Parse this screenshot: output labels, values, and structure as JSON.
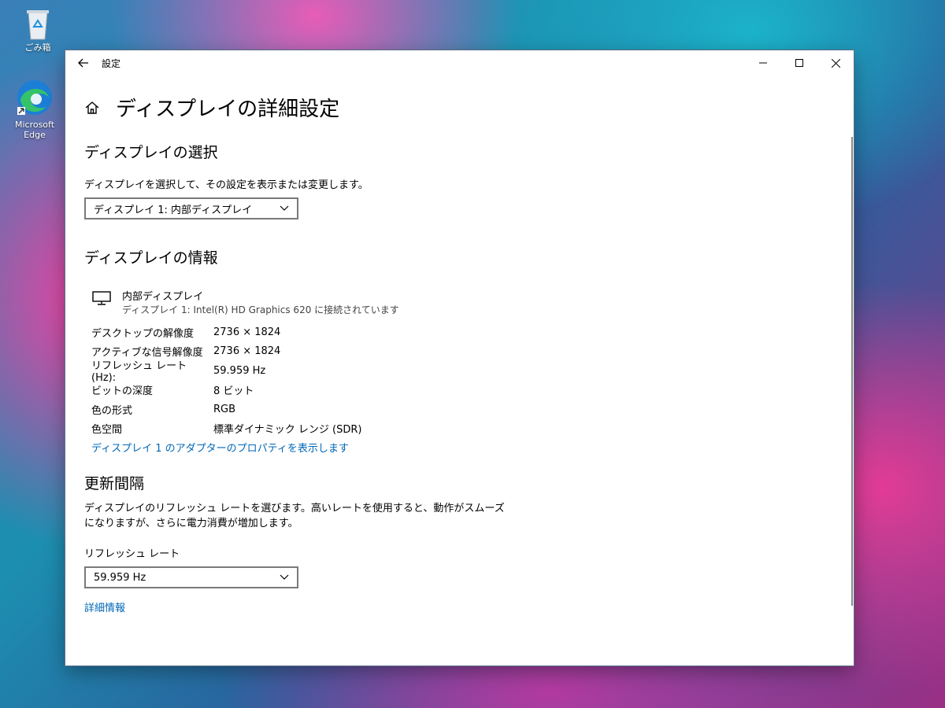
{
  "desktop": {
    "recycle_bin_label": "ごみ箱",
    "edge_label": "Microsoft Edge"
  },
  "window": {
    "title": "設定",
    "minimize": "─",
    "maximize": "☐",
    "close": "✕"
  },
  "page": {
    "title": "ディスプレイの詳細設定"
  },
  "select_display": {
    "heading": "ディスプレイの選択",
    "description": "ディスプレイを選択して、その設定を表示または変更します。",
    "selected": "ディスプレイ 1: 内部ディスプレイ"
  },
  "display_info": {
    "heading": "ディスプレイの情報",
    "monitor_name": "内部ディスプレイ",
    "monitor_sub": "ディスプレイ 1: Intel(R) HD Graphics 620 に接続されています",
    "rows": [
      {
        "label": "デスクトップの解像度",
        "value": "2736 × 1824"
      },
      {
        "label": "アクティブな信号解像度",
        "value": "2736 × 1824"
      },
      {
        "label": "リフレッシュ レート (Hz):",
        "value": "59.959 Hz"
      },
      {
        "label": "ビットの深度",
        "value": "8 ビット"
      },
      {
        "label": "色の形式",
        "value": "RGB"
      },
      {
        "label": "色空間",
        "value": "標準ダイナミック レンジ (SDR)"
      }
    ],
    "adapter_link": "ディスプレイ 1 のアダプターのプロパティを表示します"
  },
  "refresh": {
    "heading": "更新間隔",
    "description_line1": "ディスプレイのリフレッシュ レートを選びます。高いレートを使用すると、動作がスムーズ",
    "description_line2": "になりますが、さらに電力消費が増加します。",
    "rate_label": "リフレッシュ レート",
    "rate_selected": "59.959 Hz",
    "details_link": "詳細情報"
  },
  "colors": {
    "link": "#0067b8",
    "window_bg": "#ffffff"
  }
}
